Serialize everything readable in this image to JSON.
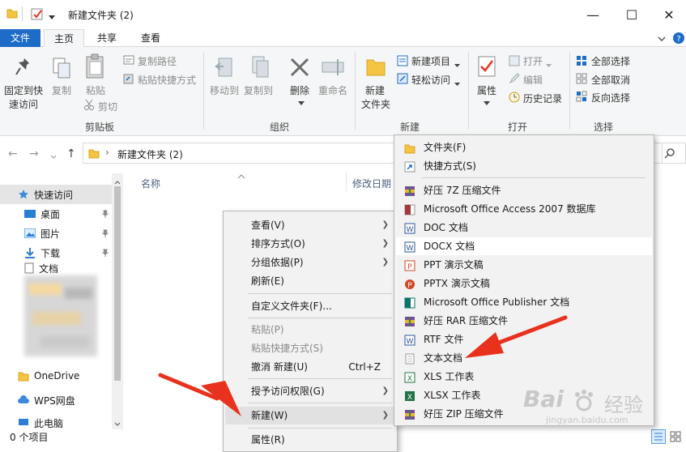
{
  "window": {
    "title": "新建文件夹 (2)",
    "minimize_glyph": "—",
    "maximize_glyph": "☐",
    "close_glyph": "✕"
  },
  "ribbon_tabs": [
    "文件",
    "主页",
    "共享",
    "查看"
  ],
  "ribbon": {
    "clipboard": {
      "pin_label_1": "固定到快",
      "pin_label_2": "速访问",
      "copy": "复制",
      "paste": "粘贴",
      "copy_path": "复制路径",
      "paste_shortcut": "粘贴快捷方式",
      "cut": "剪切",
      "group": "剪贴板"
    },
    "organize": {
      "move_to": "移动到",
      "copy_to": "复制到",
      "delete": "删除",
      "rename": "重命名",
      "group": "组织"
    },
    "new": {
      "new_folder_1": "新建",
      "new_folder_2": "文件夹",
      "new_item": "新建项目",
      "easy_access": "轻松访问",
      "group": "新建"
    },
    "open": {
      "properties": "属性",
      "open": "打开",
      "edit": "编辑",
      "history": "历史记录",
      "group": "打开"
    },
    "select": {
      "select_all": "全部选择",
      "select_none": "全部取消",
      "invert": "反向选择",
      "group": "选择"
    }
  },
  "address": {
    "path": "新建文件夹 (2)",
    "separator": "›"
  },
  "columns": {
    "name": "名称",
    "modified": "修改日期"
  },
  "nav_pane": {
    "quick_access": "快速访问",
    "items": [
      "桌面",
      "图片",
      "下载",
      "文档"
    ],
    "onedrive": "OneDrive",
    "wps": "WPS网盘",
    "this_pc": "此电脑"
  },
  "status": {
    "count": "0 个项目"
  },
  "context_menu": {
    "items": [
      {
        "label": "查看(V)",
        "submenu": true
      },
      {
        "label": "排序方式(O)",
        "submenu": true
      },
      {
        "label": "分组依据(P)",
        "submenu": true
      },
      {
        "label": "刷新(E)"
      },
      {
        "label": "自定义文件夹(F)..."
      },
      {
        "label": "粘贴(P)",
        "disabled": true
      },
      {
        "label": "粘贴快捷方式(S)",
        "disabled": true
      },
      {
        "label": "撤消 新建(U)",
        "shortcut": "Ctrl+Z"
      },
      {
        "label": "授予访问权限(G)",
        "submenu": true
      },
      {
        "label": "新建(W)",
        "submenu": true,
        "highlighted": true
      },
      {
        "label": "属性(R)"
      }
    ]
  },
  "new_submenu": {
    "items": [
      {
        "label": "文件夹(F)",
        "icon": "folder-icon"
      },
      {
        "label": "快捷方式(S)",
        "icon": "shortcut-icon"
      },
      {
        "label": "好压 7Z 压缩文件",
        "icon": "archive-icon"
      },
      {
        "label": "Microsoft Office Access 2007 数据库",
        "icon": "access-icon"
      },
      {
        "label": "DOC 文档",
        "icon": "word-icon"
      },
      {
        "label": "DOCX 文档",
        "icon": "word-icon",
        "highlighted": true
      },
      {
        "label": "PPT 演示文稿",
        "icon": "ppt-icon"
      },
      {
        "label": "PPTX 演示文稿",
        "icon": "ppt-icon"
      },
      {
        "label": "Microsoft Office Publisher 文档",
        "icon": "publisher-icon"
      },
      {
        "label": "好压 RAR 压缩文件",
        "icon": "archive-icon"
      },
      {
        "label": "RTF 文件",
        "icon": "word-icon"
      },
      {
        "label": "文本文档",
        "icon": "text-icon"
      },
      {
        "label": "XLS 工作表",
        "icon": "excel-icon"
      },
      {
        "label": "XLSX 工作表",
        "icon": "excel-icon"
      },
      {
        "label": "好压 ZIP 压缩文件",
        "icon": "archive-icon"
      }
    ]
  },
  "watermark": {
    "brand_a": "Bai",
    "brand_b": "经验",
    "url": "jingyan.baidu.com"
  },
  "colors": {
    "file_tab": "#1e6cc8",
    "folder": "#f4c542",
    "arrow": "#e8321e",
    "word": "#2b579a",
    "excel": "#217346",
    "ppt": "#d24726"
  }
}
